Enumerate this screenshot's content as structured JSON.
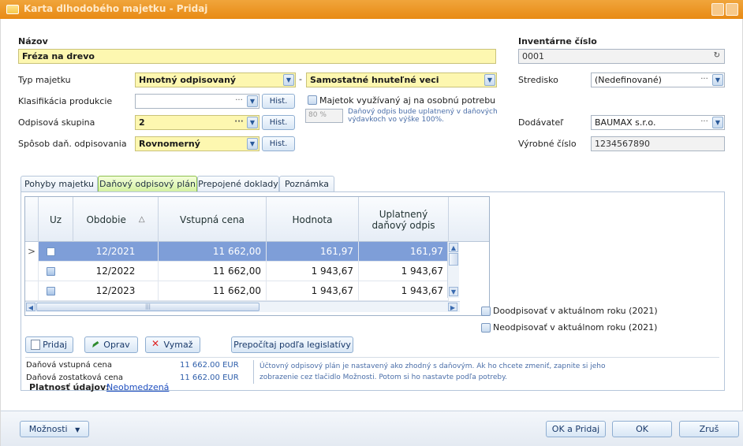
{
  "window": {
    "title": "Karta dlhodobého majetku - Pridaj"
  },
  "form": {
    "nazov_label": "Názov",
    "nazov_value": "Fréza na drevo",
    "inv_label": "Inventárne číslo",
    "inv_value": "0001",
    "typ_label": "Typ majetku",
    "typ_value": "Hmotný odpisovaný",
    "typ2_value": "Samostatné hnuteľné veci",
    "stredisko_label": "Stredisko",
    "stredisko_value": "(Nedefinované)",
    "klasif_label": "Klasifikácia produkcie",
    "klasif_value": "",
    "hist_label": "Hist.",
    "osobna_label": "Majetok využívaný aj na osobnú potrebu",
    "percent_value": "80 %",
    "osobna_note": "Daňový odpis bude uplatnený v daňových výdavkoch vo výške 100%.",
    "odpis_label": "Odpisová skupina",
    "odpis_value": "2",
    "dodavatel_label": "Dodávateľ",
    "dodavatel_value": "BAUMAX s.r.o.",
    "sposob_label": "Spôsob daň. odpisovania",
    "sposob_value": "Rovnomerný",
    "vyrobne_label": "Výrobné číslo",
    "vyrobne_value": "1234567890"
  },
  "tabs": [
    {
      "label": "Pohyby majetku",
      "active": false
    },
    {
      "label": "Daňový odpisový plán",
      "active": true
    },
    {
      "label": "Prepojené doklady",
      "active": false
    },
    {
      "label": "Poznámka",
      "active": false
    }
  ],
  "grid": {
    "columns": [
      "Uz",
      "Obdobie",
      "Vstupná cena",
      "Hodnota",
      "Uplatnený daňový odpis"
    ],
    "sort_indicator": "△",
    "rows": [
      {
        "obdobie": "12/2021",
        "vstupna": "11 662,00",
        "hodnota": "161,97",
        "uplatneny": "161,97",
        "selected": true
      },
      {
        "obdobie": "12/2022",
        "vstupna": "11 662,00",
        "hodnota": "1 943,67",
        "uplatneny": "1 943,67",
        "selected": false
      },
      {
        "obdobie": "12/2023",
        "vstupna": "11 662,00",
        "hodnota": "1 943,67",
        "uplatneny": "1 943,67",
        "selected": false
      }
    ]
  },
  "options": {
    "doodpisovat": "Doodpisovať v aktuálnom roku (2021)",
    "neodpisovat": "Neodpisovať v aktuálnom roku (2021)"
  },
  "actions": {
    "pridaj": "Pridaj",
    "oprav": "Oprav",
    "vymaz": "Vymaž",
    "prepocitaj": "Prepočítaj podľa legislatívy"
  },
  "summary": {
    "vstupna_label": "Daňová vstupná cena",
    "vstupna_value": "11 662.00 EUR",
    "zostatkova_label": "Daňová zostatková cena",
    "zostatkova_value": "11 662.00 EUR",
    "info": "Účtovný odpisový plán je nastavený ako zhodný s daňovým. Ak ho chcete zmeniť, zapnite si jeho zobrazenie cez tlačidlo Možnosti. Potom si ho nastavte podľa potreby.",
    "platnost_label": "Platnosť údajov:",
    "platnost_value": "Neobmedzená"
  },
  "footer": {
    "moznosti": "Možnosti",
    "ok_pridaj": "OK a Pridaj",
    "ok": "OK",
    "zrus": "Zruš"
  },
  "colors": {
    "accent": "#e88a14",
    "field_highlight": "#fdf7b0",
    "selected_row": "#7e9ed8",
    "active_tab": "#d3f0a2"
  }
}
